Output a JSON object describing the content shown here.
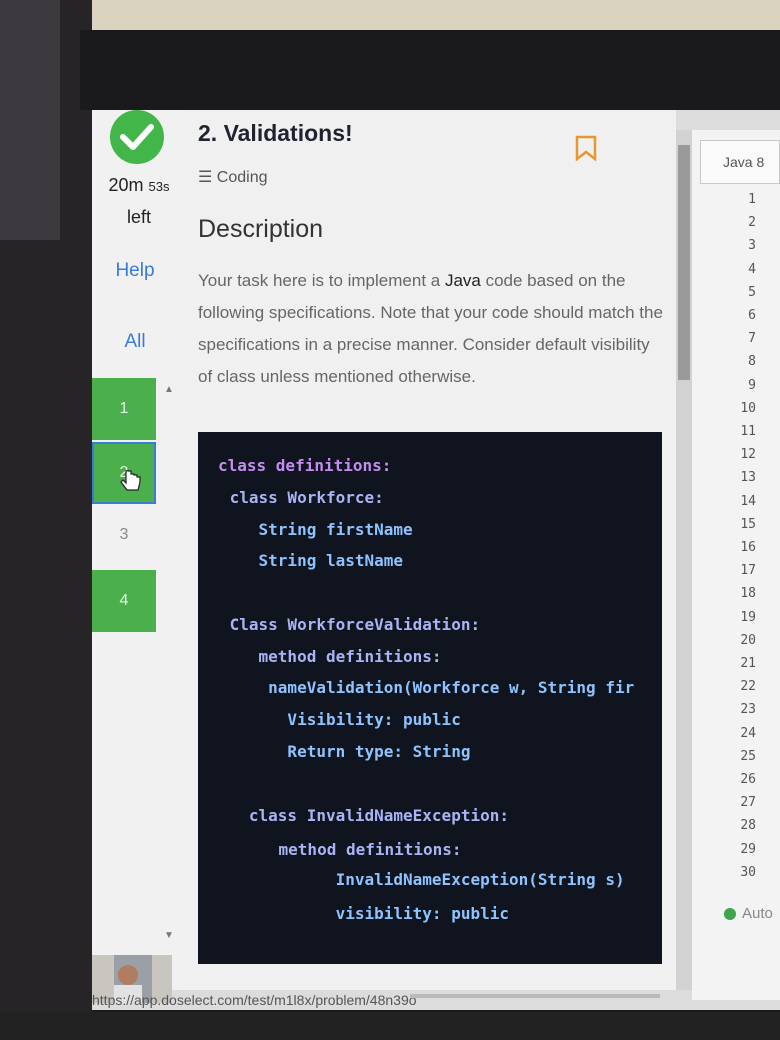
{
  "sidebar": {
    "timer_main": "20m",
    "timer_sec": "53s",
    "timer_suffix": "left",
    "help_label": "Help",
    "all_label": "All",
    "questions": [
      "1",
      "2",
      "3",
      "4"
    ]
  },
  "problem": {
    "title": "2. Validations!",
    "type_label": "Coding",
    "description_heading": "Description",
    "description_pre": "Your task here is to implement a ",
    "description_lang": "Java",
    "description_post": " code based on the following specifications. Note that your code should match the specifications in a precise manner. Consider default visibility of class unless mentioned otherwise."
  },
  "code_lines": [
    "class definitions:",
    " class Workforce:",
    "    String firstName",
    "    String lastName",
    "",
    " Class WorkforceValidation:",
    "    method definitions:",
    "     nameValidation(Workforce w, String fir",
    "       Visibility: public",
    "       Return type: String",
    "",
    "",
    "   class InvalidNameException:",
    "    method definitions:",
    "            InvalidNameException(String s)",
    "            visibility: public"
  ],
  "editor": {
    "language": "Java 8",
    "line_numbers": [
      "1",
      "2",
      "3",
      "4",
      "5",
      "6",
      "7",
      "8",
      "9",
      "10",
      "11",
      "12",
      "13",
      "14",
      "15",
      "16",
      "17",
      "18",
      "19",
      "20",
      "21",
      "22",
      "23",
      "24",
      "25",
      "26",
      "27",
      "28",
      "29",
      "30"
    ],
    "auto_label": "Auto"
  },
  "status_url": "https://app.doselect.com/test/m1l8x/problem/48n39o",
  "colors": {
    "success_green": "#43b649",
    "question_green": "#4bb04b",
    "link_blue": "#3a7bd5",
    "bookmark_orange": "#e8962e",
    "code_bg": "#10141f"
  }
}
